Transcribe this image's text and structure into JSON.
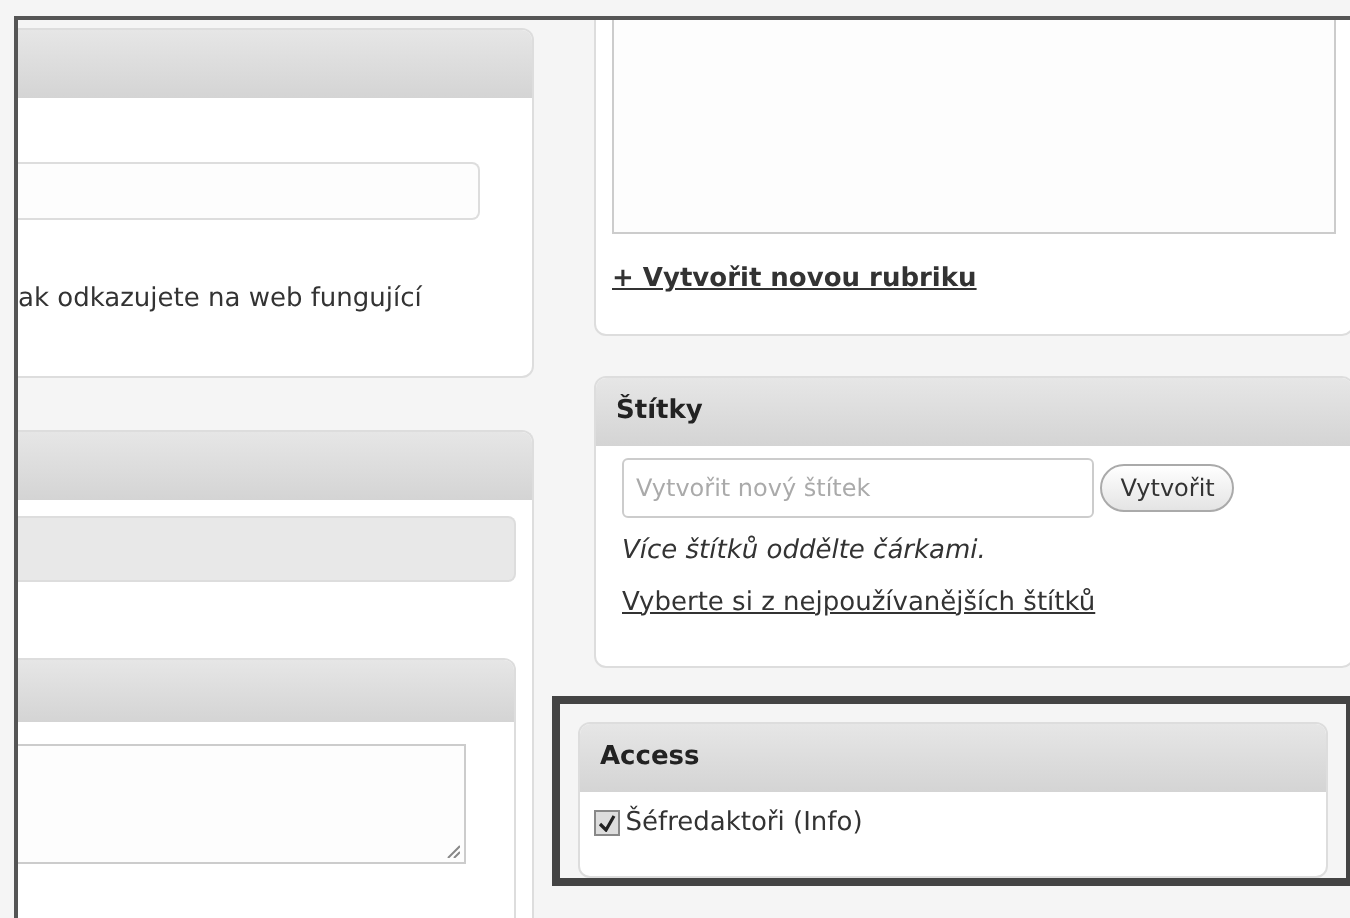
{
  "left_panels": [
    {
      "kind": "field",
      "help_text": "ak odkazujete na web fungující"
    },
    {
      "kind": "bar"
    },
    {
      "kind": "textarea"
    }
  ],
  "categories": {
    "add_link": "+ Vytvořit novou rubriku"
  },
  "tags": {
    "title": "Štítky",
    "input": {
      "placeholder": "Vytvořit nový štítek"
    },
    "button": "Vytvořit",
    "hint": "Více štítků oddělte čárkami.",
    "popular_link": "Vyberte si z nejpoužívanějších štítků"
  },
  "access": {
    "title": "Access",
    "highlighted": true,
    "options": [
      {
        "label": "Šéfredaktoři (Info)",
        "checked": true
      }
    ]
  }
}
